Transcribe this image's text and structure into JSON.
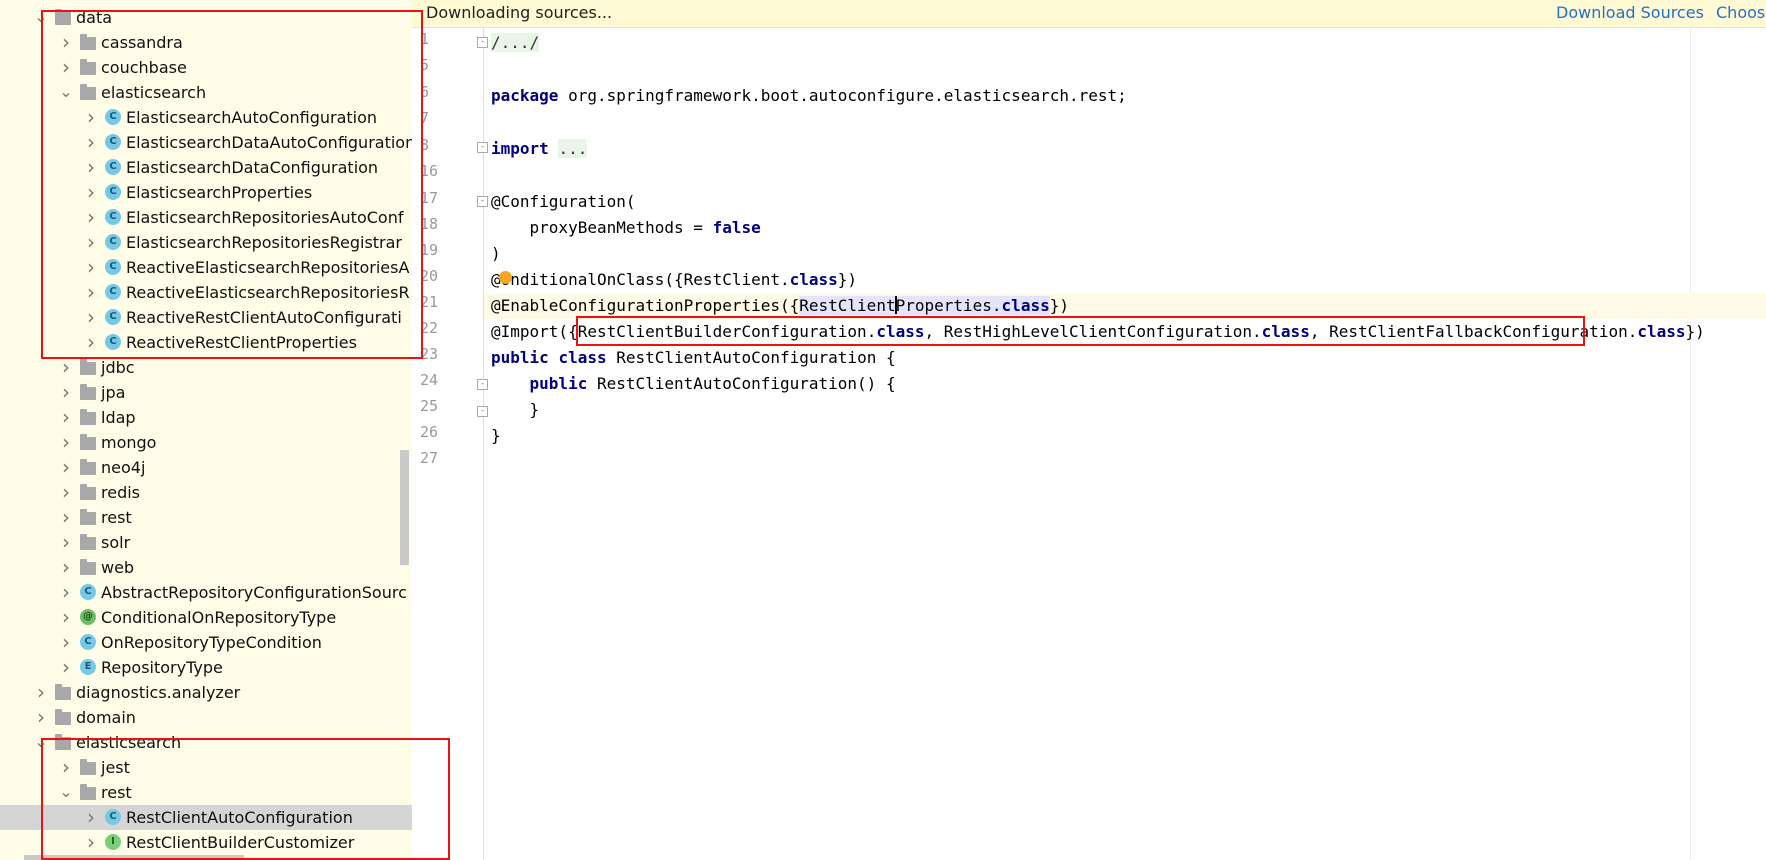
{
  "tree": {
    "rows": [
      {
        "label": "data",
        "icon": "folder-icon",
        "depth": 2,
        "expanded": true
      },
      {
        "label": "cassandra",
        "icon": "folder-icon",
        "depth": 3,
        "expanded": false
      },
      {
        "label": "couchbase",
        "icon": "folder-icon",
        "depth": 3,
        "expanded": false
      },
      {
        "label": "elasticsearch",
        "icon": "folder-icon",
        "depth": 3,
        "expanded": true
      },
      {
        "label": "ElasticsearchAutoConfiguration",
        "icon": "class-icon",
        "glyph": "C",
        "depth": 4,
        "expanded": false
      },
      {
        "label": "ElasticsearchDataAutoConfiguration",
        "icon": "class-icon",
        "glyph": "C",
        "depth": 4,
        "expanded": false
      },
      {
        "label": "ElasticsearchDataConfiguration",
        "icon": "class-icon",
        "glyph": "C",
        "depth": 4,
        "expanded": false
      },
      {
        "label": "ElasticsearchProperties",
        "icon": "class-icon",
        "glyph": "C",
        "depth": 4,
        "expanded": false
      },
      {
        "label": "ElasticsearchRepositoriesAutoConf",
        "icon": "class-icon",
        "glyph": "C",
        "depth": 4,
        "expanded": false
      },
      {
        "label": "ElasticsearchRepositoriesRegistrar",
        "icon": "class-icon",
        "glyph": "C",
        "depth": 4,
        "expanded": false
      },
      {
        "label": "ReactiveElasticsearchRepositoriesA",
        "icon": "class-icon",
        "glyph": "C",
        "depth": 4,
        "expanded": false
      },
      {
        "label": "ReactiveElasticsearchRepositoriesR",
        "icon": "class-icon",
        "glyph": "C",
        "depth": 4,
        "expanded": false
      },
      {
        "label": "ReactiveRestClientAutoConfigurati",
        "icon": "class-icon",
        "glyph": "C",
        "depth": 4,
        "expanded": false
      },
      {
        "label": "ReactiveRestClientProperties",
        "icon": "class-icon",
        "glyph": "C",
        "depth": 4,
        "expanded": false
      },
      {
        "label": "jdbc",
        "icon": "folder-icon",
        "depth": 3,
        "expanded": false
      },
      {
        "label": "jpa",
        "icon": "folder-icon",
        "depth": 3,
        "expanded": false
      },
      {
        "label": "ldap",
        "icon": "folder-icon",
        "depth": 3,
        "expanded": false
      },
      {
        "label": "mongo",
        "icon": "folder-icon",
        "depth": 3,
        "expanded": false
      },
      {
        "label": "neo4j",
        "icon": "folder-icon",
        "depth": 3,
        "expanded": false
      },
      {
        "label": "redis",
        "icon": "folder-icon",
        "depth": 3,
        "expanded": false
      },
      {
        "label": "rest",
        "icon": "folder-icon",
        "depth": 3,
        "expanded": false
      },
      {
        "label": "solr",
        "icon": "folder-icon",
        "depth": 3,
        "expanded": false
      },
      {
        "label": "web",
        "icon": "folder-icon",
        "depth": 3,
        "expanded": false
      },
      {
        "label": "AbstractRepositoryConfigurationSourc",
        "icon": "class-icon",
        "glyph": "C",
        "depth": 3,
        "expanded": false
      },
      {
        "label": "ConditionalOnRepositoryType",
        "icon": "annotation-icon",
        "glyph": "@",
        "depth": 3,
        "expanded": false
      },
      {
        "label": "OnRepositoryTypeCondition",
        "icon": "class-icon",
        "glyph": "C",
        "depth": 3,
        "expanded": false
      },
      {
        "label": "RepositoryType",
        "icon": "enum-icon",
        "glyph": "E",
        "depth": 3,
        "expanded": false
      },
      {
        "label": "diagnostics.analyzer",
        "icon": "folder-icon",
        "depth": 2,
        "expanded": false
      },
      {
        "label": "domain",
        "icon": "folder-icon",
        "depth": 2,
        "expanded": false
      },
      {
        "label": "elasticsearch",
        "icon": "folder-icon",
        "depth": 2,
        "expanded": true
      },
      {
        "label": "jest",
        "icon": "folder-icon",
        "depth": 3,
        "expanded": false
      },
      {
        "label": "rest",
        "icon": "folder-icon",
        "depth": 3,
        "expanded": true
      },
      {
        "label": "RestClientAutoConfiguration",
        "icon": "class-icon",
        "glyph": "C",
        "depth": 4,
        "expanded": false,
        "selected": true
      },
      {
        "label": "RestClientBuilderCustomizer",
        "icon": "interface-icon",
        "glyph": "I",
        "depth": 4,
        "expanded": false
      }
    ]
  },
  "banner": {
    "message": "Downloading sources...",
    "download_sources": "Download Sources",
    "choose": "Choose"
  },
  "editor": {
    "line_numbers": [
      "1",
      "5",
      "6",
      "7",
      "8",
      "16",
      "17",
      "18",
      "19",
      "20",
      "21",
      "22",
      "23",
      "24",
      "25",
      "26",
      "27"
    ],
    "tokens": {
      "l1_fold": "/.../",
      "package_kw": "package",
      "package_name": " org.springframework.boot.autoconfigure.elasticsearch.rest;",
      "import_kw": "import",
      "import_fold": "...",
      "configuration": "@Configuration(",
      "proxy_indent": "    proxyBeanMethods = ",
      "false_kw": "false",
      "close_paren": ")",
      "cond_at": "@",
      "cond_rest": "onditionalOnClass({RestClient.",
      "class_kw": "class",
      "cond_end": "})",
      "enable_start": "@EnableConfigurationProperties({",
      "enable_hl_a": "RestClient",
      "enable_hl_b": "Properties.",
      "enable_end": "})",
      "import_start": "@Import({",
      "import_b": "RestClientBuilderConfiguration.",
      "import_c": ", RestHighLevelClientConfiguration.",
      "import_d": ", RestClientFallbackConfiguration.",
      "import_end": "})",
      "public_kw": "public",
      "class_decl_kw": "class",
      "class_name": " RestClientAutoConfiguration {",
      "ctor_indent": "    ",
      "ctor_public_kw": "public",
      "ctor_rest": " RestClientAutoConfiguration() {",
      "ctor_close": "    }",
      "class_close": "}"
    }
  }
}
